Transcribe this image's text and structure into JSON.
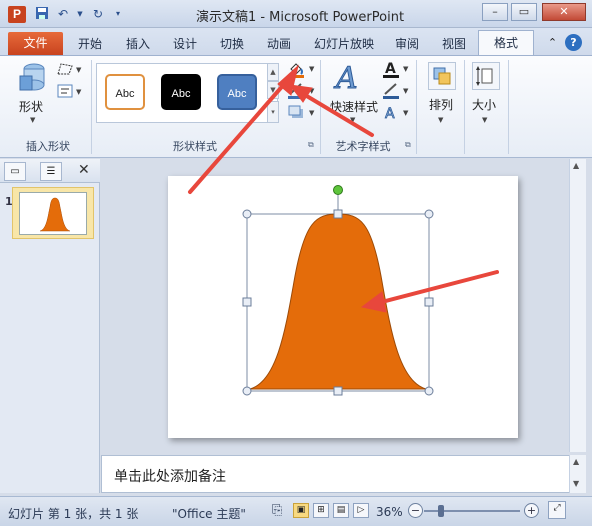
{
  "app": {
    "title": "演示文稿1 - Microsoft PowerPoint",
    "logo_letter": "P",
    "window_controls": {
      "minimize": "–",
      "maximize": "▭",
      "close": "✕"
    }
  },
  "tabs": {
    "file": "文件",
    "items": [
      "开始",
      "插入",
      "设计",
      "切换",
      "动画",
      "幻灯片放映",
      "审阅",
      "视图"
    ],
    "active": "格式"
  },
  "ribbon": {
    "insert_shapes": {
      "shapes_label": "形状",
      "group_label": "插入形状"
    },
    "shape_styles": {
      "swatch_label": "Abc",
      "group_label": "形状样式",
      "swatches": [
        {
          "fill": "#ffffff",
          "border": "#e0913f",
          "text": "#222222"
        },
        {
          "fill": "#000000",
          "border": "#000000",
          "text": "#ffffff"
        },
        {
          "fill": "#4f7fc1",
          "border": "#36609c",
          "text": "#ffffff"
        }
      ]
    },
    "wordart": {
      "quick_styles_label": "快速样式",
      "group_label": "艺术字样式"
    },
    "arrange": {
      "label": "排列"
    },
    "size": {
      "label": "大小"
    }
  },
  "slides_panel": {
    "slide_number": "1"
  },
  "slide": {
    "shape_color": "#e46c0a",
    "handle_color": "#5ec53c"
  },
  "notes": {
    "placeholder": "单击此处添加备注"
  },
  "status": {
    "slide_info": "幻灯片 第 1 张，共 1 张",
    "theme": "\"Office 主题\"",
    "zoom_percent": "36%",
    "zoom_level": 0.36
  },
  "annotations": {
    "arrow_color": "#e8473c"
  }
}
